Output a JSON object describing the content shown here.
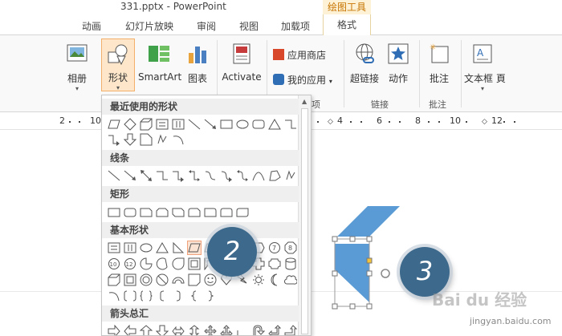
{
  "window": {
    "title": "331.pptx - PowerPoint",
    "context_tab_group": "绘图工具"
  },
  "tabs": [
    "动画",
    "幻灯片放映",
    "审阅",
    "视图",
    "加载项",
    "格式"
  ],
  "ribbon": {
    "album": "相册",
    "shapes": "形状",
    "smartart": "SmartArt",
    "chart": "图表",
    "activate": "Activate",
    "app_store": "应用商店",
    "my_apps": "我的应用",
    "group_apps_suffix": "项",
    "hyperlink": "超链接",
    "action": "动作",
    "group_links": "链接",
    "comment": "批注",
    "group_comments": "批注",
    "textbox": "文本框",
    "textbox_more": "頁"
  },
  "ruler": {
    "ticks": [
      "2",
      "10",
      "4",
      "6",
      "8",
      "10",
      "12"
    ]
  },
  "shapes_menu": {
    "recent": "最近使用的形状",
    "lines": "线条",
    "rectangles": "矩形",
    "basic": "基本形状",
    "arrows": "箭头总汇"
  },
  "callouts": [
    "2",
    "3"
  ],
  "colors": {
    "accent": "#c77400",
    "shape_fill": "#5b9bd5",
    "callout": "#3d6a8c"
  },
  "watermark": {
    "logo": "Bai du 经验",
    "site": "jingyan.baidu.com"
  }
}
